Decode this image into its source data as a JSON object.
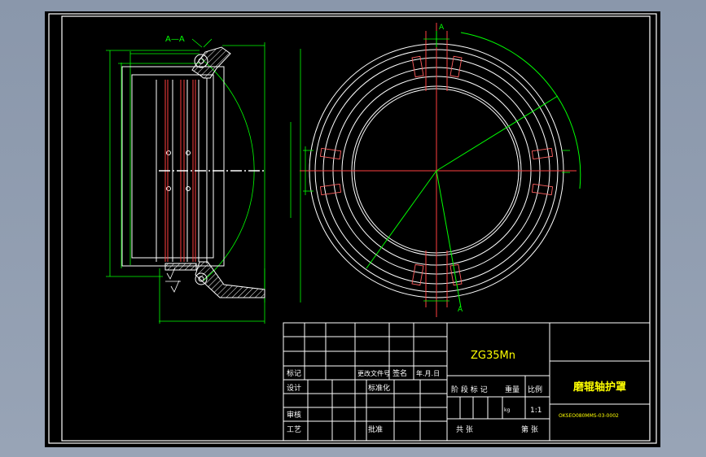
{
  "colors": {
    "background": "#000000",
    "frame": "#ffffff",
    "dimension": "#00ff00",
    "centerline": "#ff0000",
    "cyan": "#00ffff",
    "title_text": "#ffff00",
    "window_bg": "#8c99ad"
  },
  "drawing": {
    "section_label": "A—A",
    "section_letter": "A",
    "material": "ZG35Mn",
    "part_name": "磨辊轴护罩",
    "drawing_number": "OKSEO080MMS-03-0002",
    "scale": "1:1"
  },
  "title_block": {
    "mark": "标记",
    "change_doc": "更改文件号",
    "signature": "签名",
    "date": "年.月.日",
    "design": "设计",
    "standardize": "标准化",
    "review": "审核",
    "process": "工艺",
    "approve": "批准",
    "stage_mark": "阶 段 标 记",
    "weight": "重量",
    "ratio": "比例",
    "total": "共 张",
    "sheet": "第 张",
    "weight_unit": "kg"
  }
}
